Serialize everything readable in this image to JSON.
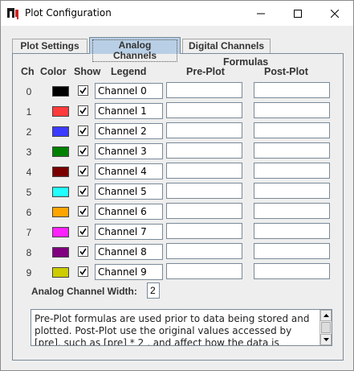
{
  "window": {
    "title": "Plot Configuration"
  },
  "tabs": [
    {
      "label": "Plot Settings",
      "active": false
    },
    {
      "label": "Analog Channels",
      "active": true
    },
    {
      "label": "Digital Channels",
      "active": false
    }
  ],
  "headers": {
    "ch": "Ch",
    "color": "Color",
    "show": "Show",
    "legend": "Legend",
    "formulas": "Formulas",
    "pre_plot": "Pre-Plot",
    "post_plot": "Post-Plot"
  },
  "channels": [
    {
      "ch": "0",
      "color": "#000000",
      "show": true,
      "legend": "Channel 0",
      "pre": "",
      "post": ""
    },
    {
      "ch": "1",
      "color": "#ff3b3b",
      "show": true,
      "legend": "Channel 1",
      "pre": "",
      "post": ""
    },
    {
      "ch": "2",
      "color": "#3b3bff",
      "show": true,
      "legend": "Channel 2",
      "pre": "",
      "post": ""
    },
    {
      "ch": "3",
      "color": "#008000",
      "show": true,
      "legend": "Channel 3",
      "pre": "",
      "post": ""
    },
    {
      "ch": "4",
      "color": "#7a0000",
      "show": true,
      "legend": "Channel 4",
      "pre": "",
      "post": ""
    },
    {
      "ch": "5",
      "color": "#22ffff",
      "show": true,
      "legend": "Channel 5",
      "pre": "",
      "post": ""
    },
    {
      "ch": "6",
      "color": "#ffa500",
      "show": true,
      "legend": "Channel 6",
      "pre": "",
      "post": ""
    },
    {
      "ch": "7",
      "color": "#ff22ff",
      "show": true,
      "legend": "Channel 7",
      "pre": "",
      "post": ""
    },
    {
      "ch": "8",
      "color": "#800080",
      "show": true,
      "legend": "Channel 8",
      "pre": "",
      "post": ""
    },
    {
      "ch": "9",
      "color": "#cccc00",
      "show": true,
      "legend": "Channel 9",
      "pre": "",
      "post": ""
    }
  ],
  "width": {
    "label": "Analog Channel Width:",
    "value": "2"
  },
  "help_text": "Pre-Plot formulas are used prior to data being stored and plotted. Post-Plot use the original values accessed by [pre], such as [pre] * 2 , and affect how the data is plotted. With"
}
